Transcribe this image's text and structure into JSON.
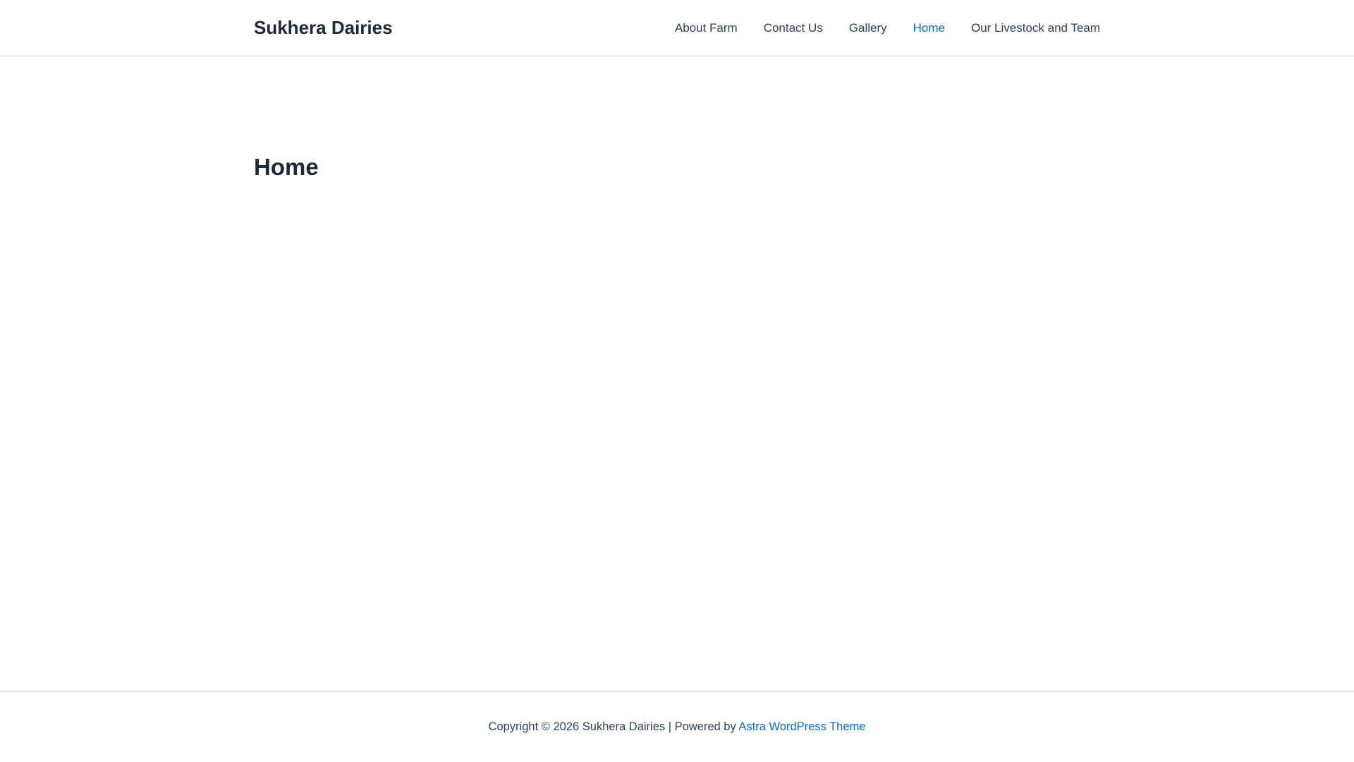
{
  "header": {
    "site_title": "Sukhera Dairies",
    "nav": [
      {
        "label": "About Farm"
      },
      {
        "label": "Contact Us"
      },
      {
        "label": "Gallery"
      },
      {
        "label": "Home",
        "active": true
      },
      {
        "label": "Our Livestock and Team"
      }
    ]
  },
  "main": {
    "page_title": "Home"
  },
  "footer": {
    "copyright": "Copyright © 2026 Sukhera Dairies | Powered by ",
    "theme_link": "Astra WordPress Theme"
  },
  "colors": {
    "text": "#1e293b",
    "accent": "#046bd2"
  }
}
